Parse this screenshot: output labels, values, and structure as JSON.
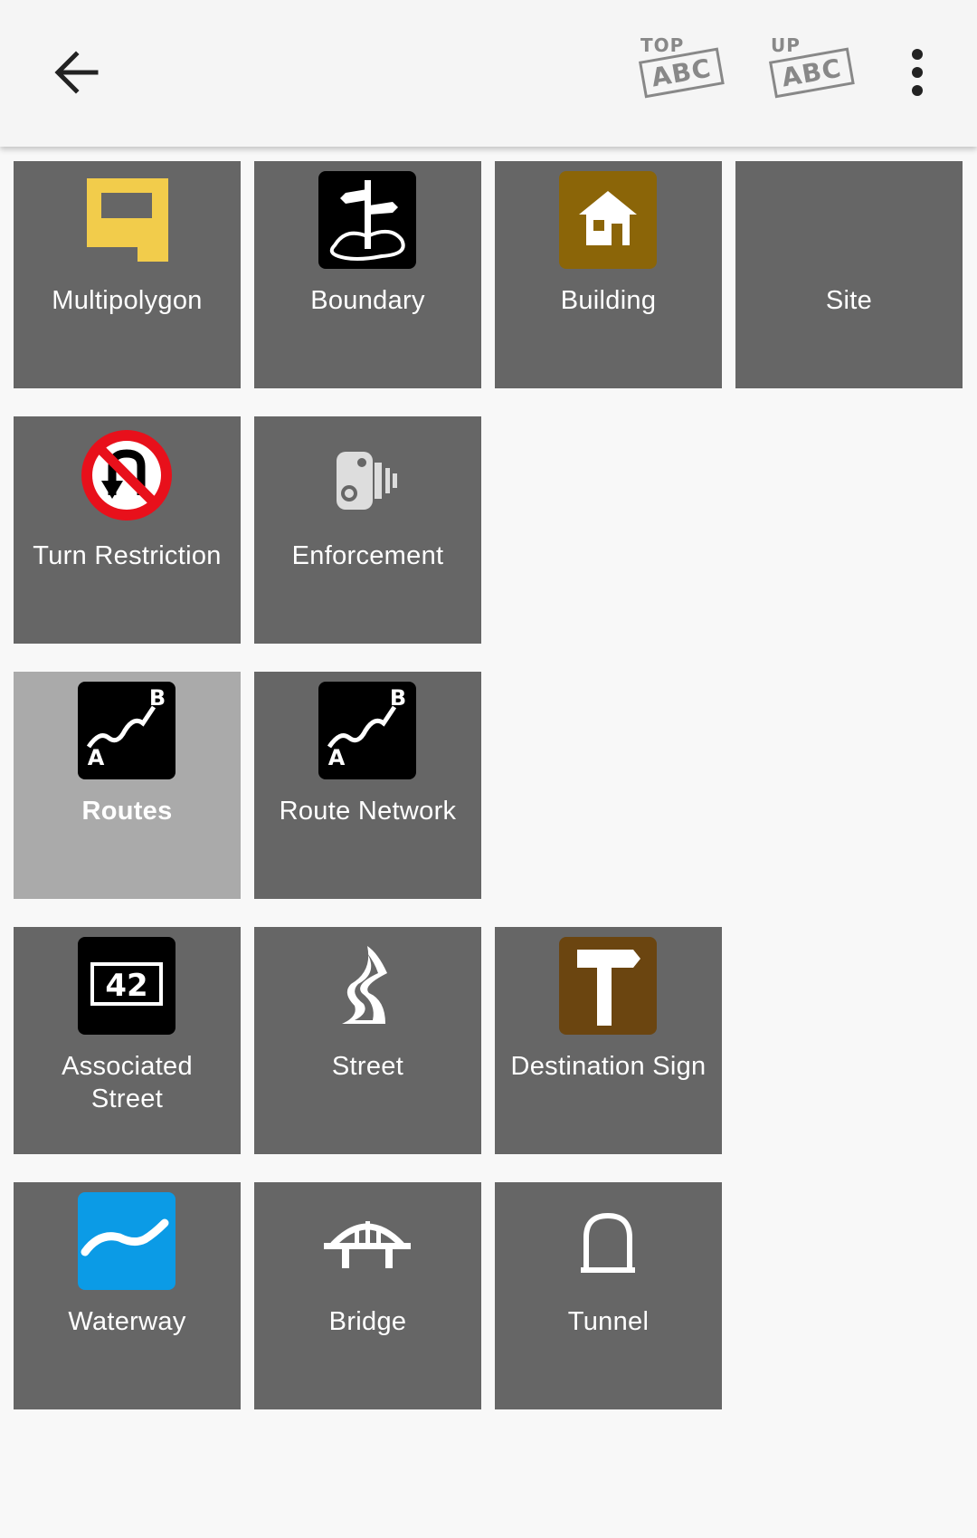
{
  "toolbar": {
    "back_icon": "arrow-left-icon",
    "top_small": "TOP",
    "top_box": "ABC",
    "up_small": "UP",
    "up_box": "ABC",
    "more_icon": "more-vertical-icon"
  },
  "tiles": [
    {
      "label": "Multipolygon",
      "icon": "multipolygon-icon",
      "selected": false
    },
    {
      "label": "Boundary",
      "icon": "boundary-icon",
      "selected": false
    },
    {
      "label": "Building",
      "icon": "building-icon",
      "selected": false
    },
    {
      "label": "Site",
      "icon": "",
      "selected": false
    },
    {
      "label": "Turn Restriction",
      "icon": "no-u-turn-icon",
      "selected": false
    },
    {
      "label": "Enforcement",
      "icon": "speed-camera-icon",
      "selected": false
    },
    {
      "label": "Routes",
      "icon": "route-icon",
      "selected": true
    },
    {
      "label": "Route Network",
      "icon": "route-icon",
      "selected": false
    },
    {
      "label": "Associated\nStreet",
      "icon": "street-number-icon",
      "selected": false
    },
    {
      "label": "Street",
      "icon": "street-icon",
      "selected": false
    },
    {
      "label": "Destination Sign",
      "icon": "destination-sign-icon",
      "selected": false
    },
    {
      "label": "Waterway",
      "icon": "waterway-icon",
      "selected": false
    },
    {
      "label": "Bridge",
      "icon": "bridge-icon",
      "selected": false
    },
    {
      "label": "Tunnel",
      "icon": "tunnel-icon",
      "selected": false
    }
  ],
  "icon_text": {
    "route_a": "A",
    "route_b": "B",
    "street_number": "42"
  },
  "colors": {
    "tile_bg": "#666666",
    "tile_selected_bg": "#aaaaaa",
    "multipolygon": "#f2cc4b",
    "building_bg": "#8b6508",
    "destination_bg": "#6b4510",
    "waterway_bg": "#0b9be6",
    "no_entry_red": "#e8101b"
  }
}
